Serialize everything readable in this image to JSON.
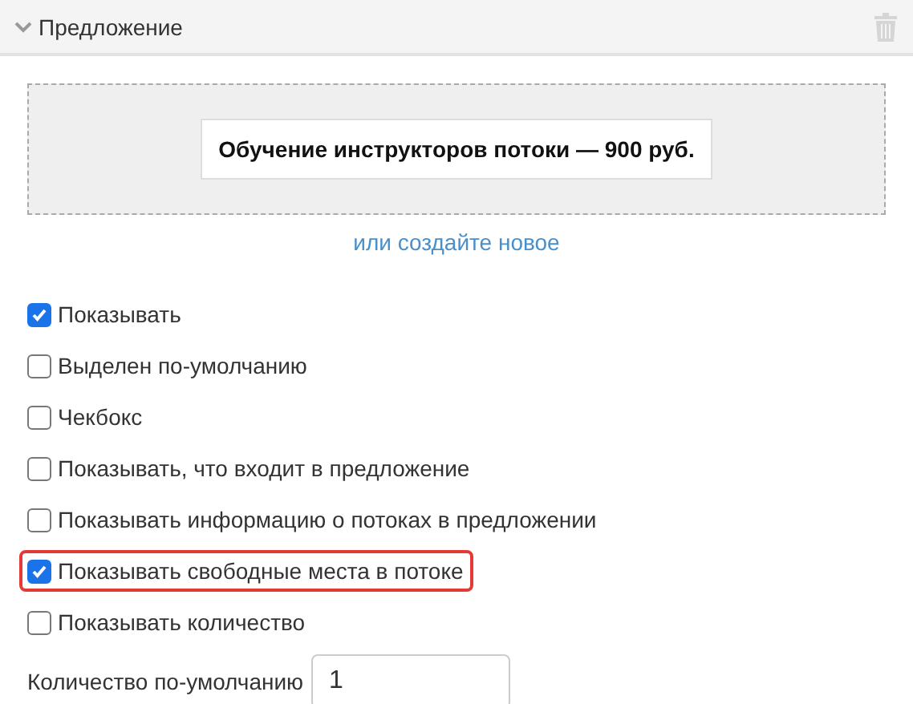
{
  "section": {
    "title": "Предложение",
    "expanded": true
  },
  "offer": {
    "card": "Обучение инструкторов потоки — 900 руб.",
    "create_link": "или создайте новое"
  },
  "options": [
    {
      "label": "Показывать",
      "checked": true,
      "highlighted": false
    },
    {
      "label": "Выделен по-умолчанию",
      "checked": false,
      "highlighted": false
    },
    {
      "label": "Чекбокс",
      "checked": false,
      "highlighted": false
    },
    {
      "label": "Показывать, что входит в предложение",
      "checked": false,
      "highlighted": false
    },
    {
      "label": "Показывать информацию о потоках в предложении",
      "checked": false,
      "highlighted": false
    },
    {
      "label": "Показывать свободные места в потоке",
      "checked": true,
      "highlighted": true
    },
    {
      "label": "Показывать количество",
      "checked": false,
      "highlighted": false
    }
  ],
  "default_quantity": {
    "label": "Количество по-умолчанию",
    "value": "1"
  }
}
